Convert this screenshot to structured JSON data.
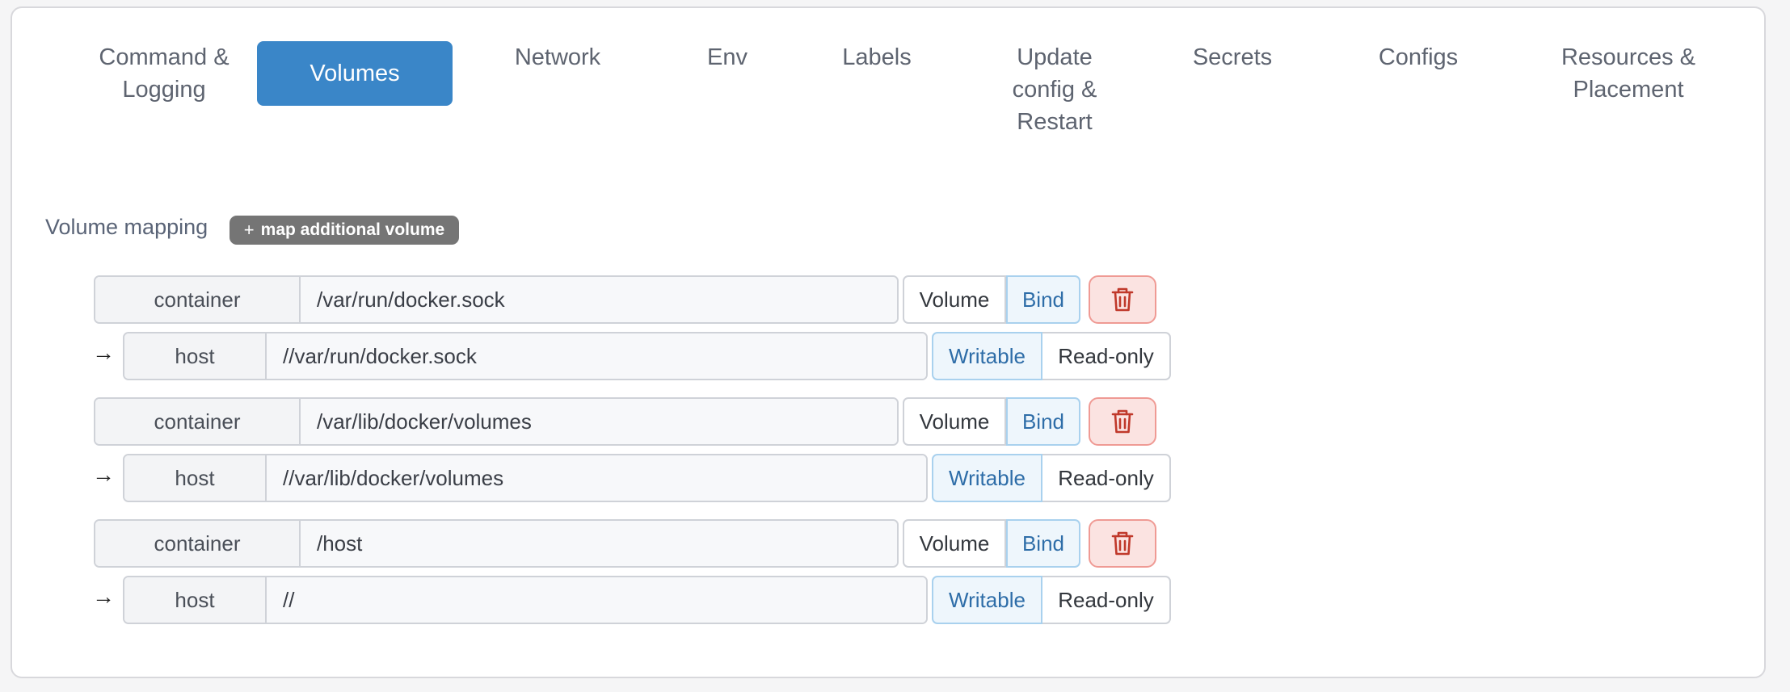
{
  "tabs": [
    {
      "label": "Command &\nLogging",
      "active": false
    },
    {
      "label": "Volumes",
      "active": true
    },
    {
      "label": "Network",
      "active": false
    },
    {
      "label": "Env",
      "active": false
    },
    {
      "label": "Labels",
      "active": false
    },
    {
      "label": "Update\nconfig &\nRestart",
      "active": false
    },
    {
      "label": "Secrets",
      "active": false
    },
    {
      "label": "Configs",
      "active": false
    },
    {
      "label": "Resources &\nPlacement",
      "active": false
    }
  ],
  "volumes": {
    "section_label": "Volume mapping",
    "add_label": "map additional volume",
    "add_icon": "+",
    "container_label": "container",
    "host_label": "host",
    "type_volume": "Volume",
    "type_bind": "Bind",
    "mode_writable": "Writable",
    "mode_readonly": "Read-only",
    "arrow_glyph": "→",
    "entries": [
      {
        "container": "/var/run/docker.sock",
        "host": "//var/run/docker.sock",
        "type": "Bind",
        "mode": "Writable"
      },
      {
        "container": "/var/lib/docker/volumes",
        "host": "//var/lib/docker/volumes",
        "type": "Bind",
        "mode": "Writable"
      },
      {
        "container": "/host",
        "host": "//",
        "type": "Bind",
        "mode": "Writable"
      }
    ]
  },
  "colors": {
    "accent": "#3a86c8",
    "danger": "#c0392b",
    "selected_bg": "#eef6fc"
  }
}
